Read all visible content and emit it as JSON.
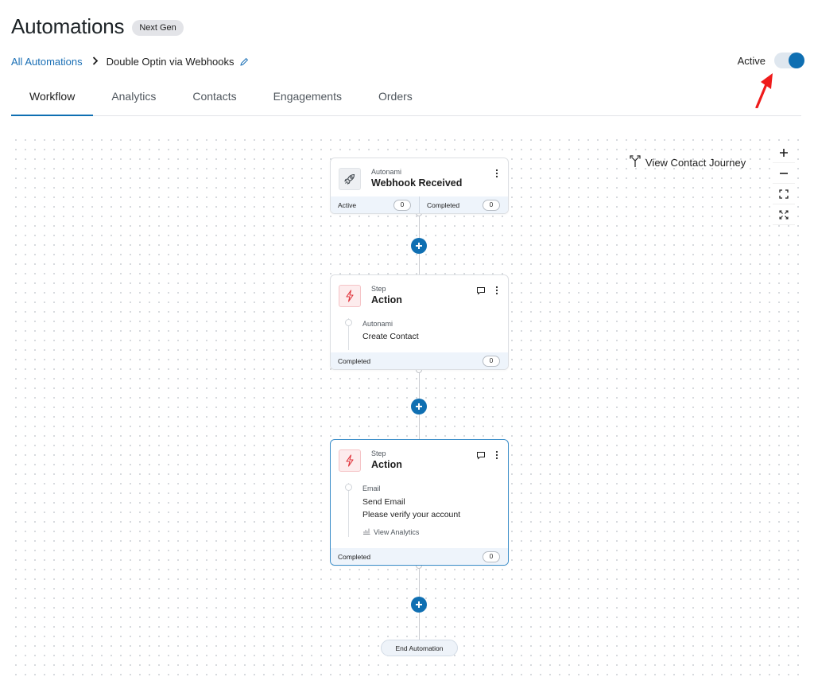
{
  "header": {
    "title": "Automations",
    "badge": "Next Gen"
  },
  "breadcrumb": {
    "root": "All Automations",
    "current": "Double Optin via Webhooks"
  },
  "status": {
    "label": "Active",
    "enabled": true
  },
  "tabs": [
    {
      "label": "Workflow",
      "active": true
    },
    {
      "label": "Analytics",
      "active": false
    },
    {
      "label": "Contacts",
      "active": false
    },
    {
      "label": "Engagements",
      "active": false
    },
    {
      "label": "Orders",
      "active": false
    }
  ],
  "canvas": {
    "view_journey": "View Contact Journey",
    "zoom_controls": [
      "+",
      "−",
      "fit-icon",
      "expand-icon"
    ]
  },
  "nodes": [
    {
      "sub": "Autonami",
      "title": "Webhook Received",
      "icon": "rocket-icon",
      "footer": {
        "active_label": "Active",
        "active_count": "0",
        "completed_label": "Completed",
        "completed_count": "0"
      }
    },
    {
      "sub": "Step",
      "title": "Action",
      "icon": "bolt-icon",
      "body_sub": "Autonami",
      "body_lines": [
        "Create Contact"
      ],
      "footer": {
        "completed_label": "Completed",
        "completed_count": "0"
      }
    },
    {
      "sub": "Step",
      "title": "Action",
      "icon": "bolt-icon",
      "body_sub": "Email",
      "body_lines": [
        "Send Email",
        "Please verify your account"
      ],
      "analytics_label": "View Analytics",
      "footer": {
        "completed_label": "Completed",
        "completed_count": "0"
      }
    }
  ],
  "end_label": "End Automation",
  "colors": {
    "accent": "#0f6fb2",
    "link": "#1a6fb5",
    "action_icon": "#e0323a",
    "annotation_arrow": "#ef1b1b"
  }
}
